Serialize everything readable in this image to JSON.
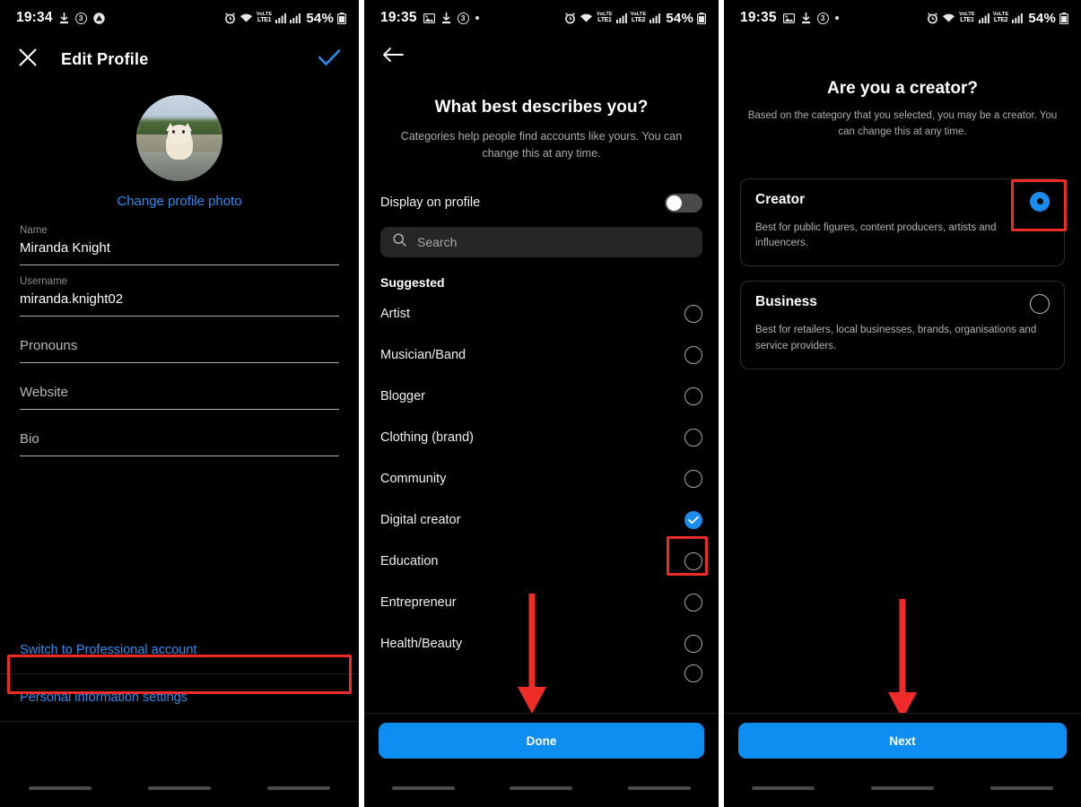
{
  "panel1": {
    "status": {
      "time": "19:34",
      "icons_left": [
        "download-icon",
        "circle-3-icon",
        "app-drop-icon"
      ],
      "icons_right": [
        "alarm-icon",
        "wifi-icon",
        "volte-lte1-signal-icon",
        "signal-icon"
      ],
      "battery_percent": "54%",
      "volte_label_top": "VoLTE",
      "volte_label_bottom": "LTE1"
    },
    "header": {
      "title": "Edit Profile",
      "close_icon": "close-icon",
      "confirm_icon": "check-icon"
    },
    "avatar_alt": "profile-photo-cat",
    "change_photo_label": "Change profile photo",
    "fields": [
      {
        "label": "Name",
        "value": "Miranda Knight",
        "placeholder": ""
      },
      {
        "label": "Username",
        "value": "miranda.knight02",
        "placeholder": ""
      },
      {
        "label": "",
        "value": "",
        "placeholder": "Pronouns"
      },
      {
        "label": "",
        "value": "",
        "placeholder": "Website"
      },
      {
        "label": "",
        "value": "",
        "placeholder": "Bio"
      }
    ],
    "links": [
      {
        "label": "Switch to Professional account",
        "highlighted": true
      },
      {
        "label": "Personal information settings",
        "highlighted": false
      }
    ]
  },
  "panel2": {
    "status": {
      "time": "19:35",
      "icons_left": [
        "image-icon",
        "download-icon",
        "circle-3-icon",
        "dot-icon"
      ],
      "battery_percent": "54%",
      "volte1_top": "VoLTE",
      "volte1_bottom": "LTE1",
      "volte2_top": "VoLTE",
      "volte2_bottom": "LTE2"
    },
    "back_icon": "back-arrow-icon",
    "title": "What best describes you?",
    "subtitle": "Categories help people find accounts like yours. You can change this at any time.",
    "toggle": {
      "label": "Display on profile",
      "state": "off"
    },
    "search": {
      "placeholder": "Search",
      "icon": "search-icon"
    },
    "section_label": "Suggested",
    "categories": [
      {
        "label": "Artist",
        "selected": false
      },
      {
        "label": "Musician/Band",
        "selected": false
      },
      {
        "label": "Blogger",
        "selected": false
      },
      {
        "label": "Clothing (brand)",
        "selected": false
      },
      {
        "label": "Community",
        "selected": false
      },
      {
        "label": "Digital creator",
        "selected": true,
        "highlighted": true
      },
      {
        "label": "Education",
        "selected": false
      },
      {
        "label": "Entrepreneur",
        "selected": false
      },
      {
        "label": "Health/Beauty",
        "selected": false
      }
    ],
    "primary_button": "Done"
  },
  "panel3": {
    "status": {
      "time": "19:35",
      "battery_percent": "54%",
      "volte1_top": "VoLTE",
      "volte1_bottom": "LTE1",
      "volte2_top": "VoLTE",
      "volte2_bottom": "LTE2"
    },
    "title": "Are you a creator?",
    "subtitle": "Based on the category that you selected, you may be a creator. You can change this at any time.",
    "options": [
      {
        "title": "Creator",
        "description": "Best for public figures, content producers, artists and influencers.",
        "selected": true,
        "highlighted": true
      },
      {
        "title": "Business",
        "description": "Best for retailers, local businesses, brands, organisations and service providers.",
        "selected": false,
        "highlighted": false
      }
    ],
    "primary_button": "Next"
  },
  "colors": {
    "background": "#000000",
    "accent_blue": "#0d8ef0",
    "link_blue": "#2f8cf0",
    "highlight_red": "#ee2b26",
    "muted_text": "#adadad",
    "page_gap": "#ffffff"
  }
}
